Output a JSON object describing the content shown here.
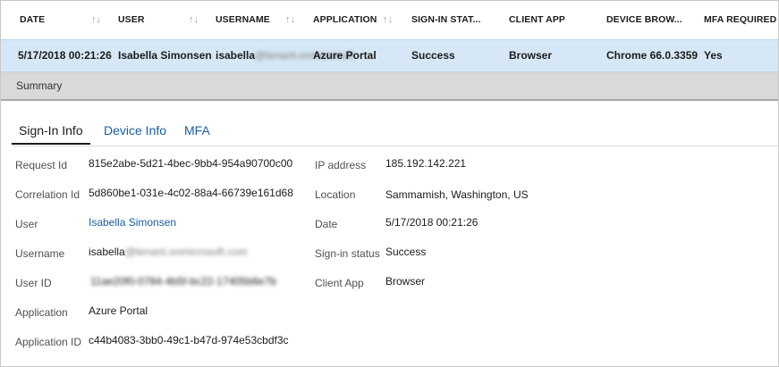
{
  "columns": [
    {
      "label": "DATE",
      "sortable": true
    },
    {
      "label": "USER",
      "sortable": true
    },
    {
      "label": "USERNAME",
      "sortable": true
    },
    {
      "label": "APPLICATION",
      "sortable": true
    },
    {
      "label": "SIGN-IN STAT...",
      "sortable": false
    },
    {
      "label": "CLIENT APP",
      "sortable": false
    },
    {
      "label": "DEVICE BROW...",
      "sortable": false
    },
    {
      "label": "MFA REQUIRED",
      "sortable": false
    }
  ],
  "sort_icon": "sort-arrows-icon",
  "row": {
    "date": "5/17/2018 00:21:26",
    "user": "Isabella Simonsen",
    "username_visible": "isabella",
    "username_blurred": "@tenant.onmicrosoft",
    "application": "Azure Portal",
    "status": "Success",
    "client_app": "Browser",
    "device_browser": "Chrome 66.0.3359",
    "mfa_required": "Yes"
  },
  "summary_label": "Summary",
  "tabs": [
    {
      "label": "Sign-In Info",
      "active": true
    },
    {
      "label": "Device Info",
      "active": false
    },
    {
      "label": "MFA",
      "active": false
    }
  ],
  "details_left": {
    "request_id": {
      "label": "Request Id",
      "value": "815e2abe-5d21-4bec-9bb4-954a90700c00"
    },
    "correlation_id": {
      "label": "Correlation Id",
      "value": "5d860be1-031e-4c02-88a4-66739e161d68"
    },
    "user": {
      "label": "User",
      "value": "Isabella Simonsen"
    },
    "username": {
      "label": "Username",
      "value_visible": "isabella",
      "value_blurred": "@tenant.onmicrosoft.com"
    },
    "user_id": {
      "label": "User ID",
      "value_blurred": "11ae20f0-0784-4b5f-bc22-17405b6e7b"
    },
    "application": {
      "label": "Application",
      "value": "Azure Portal"
    },
    "application_id": {
      "label": "Application ID",
      "value": "c44b4083-3bb0-49c1-b47d-974e53cbdf3c"
    }
  },
  "details_right": {
    "ip_address": {
      "label": "IP address",
      "value": "185.192.142.221"
    },
    "location": {
      "label": "Location",
      "value": "Sammamish, Washington, US"
    },
    "date": {
      "label": "Date",
      "value": "5/17/2018 00:21:26"
    },
    "signin_status": {
      "label": "Sign-in status",
      "value": "Success"
    },
    "client_app": {
      "label": "Client App",
      "value": "Browser"
    }
  },
  "colors": {
    "selected_row": "#d6e8f7",
    "link": "#1a5ea0",
    "summary_bar": "#d9d9d9"
  }
}
